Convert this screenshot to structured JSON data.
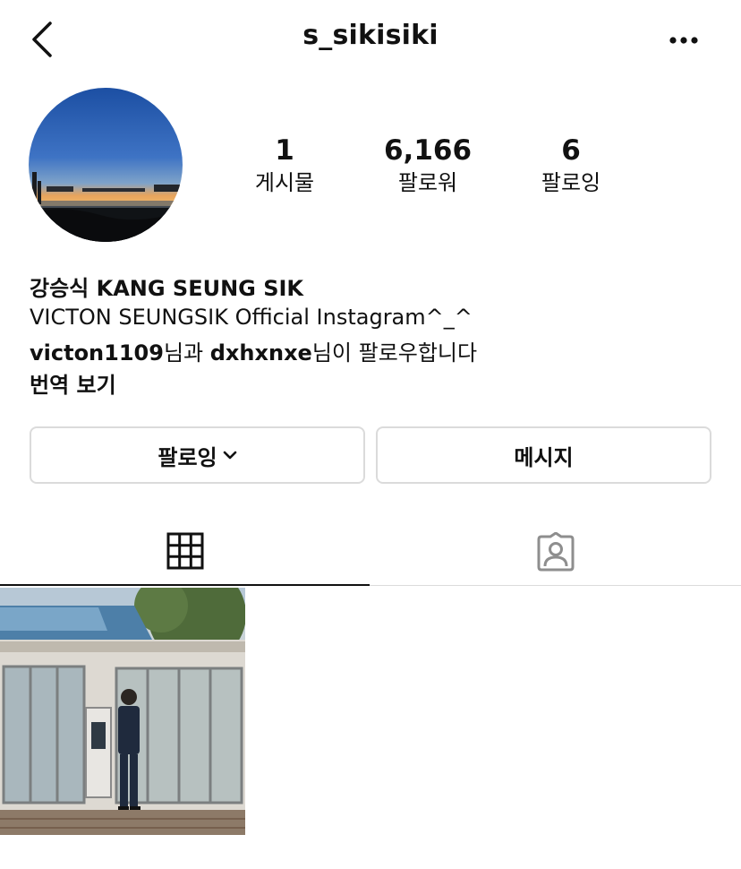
{
  "header": {
    "username": "s_sikisiki",
    "back_icon": "chevron-left-icon",
    "more_icon": "more-horizontal-icon"
  },
  "profile": {
    "avatar": "sunset-cityscape-avatar",
    "stats": [
      {
        "value": "1",
        "label": "게시물"
      },
      {
        "value": "6,166",
        "label": "팔로워"
      },
      {
        "value": "6",
        "label": "팔로잉"
      }
    ],
    "display_name": "강승식 KANG SEUNG SIK",
    "bio": "VICTON SEUNGSIK Official Instagram^_^",
    "followed_by": {
      "user1": "victon1109",
      "connector": "님과 ",
      "user2": "dxhxnxe",
      "suffix": "님이 팔로우합니다"
    },
    "translate_label": "번역 보기"
  },
  "actions": {
    "following_label": "팔로잉",
    "message_label": "메시지"
  },
  "tabs": [
    {
      "icon": "grid-icon",
      "active": true
    },
    {
      "icon": "tagged-person-icon",
      "active": false
    }
  ],
  "posts": [
    {
      "thumbnail": "man-in-suit-outside-glass-storefront"
    }
  ],
  "colors": {
    "text": "#111111",
    "border": "#dbdbdb",
    "background": "#ffffff",
    "tagged_icon": "#8e8e8e"
  }
}
